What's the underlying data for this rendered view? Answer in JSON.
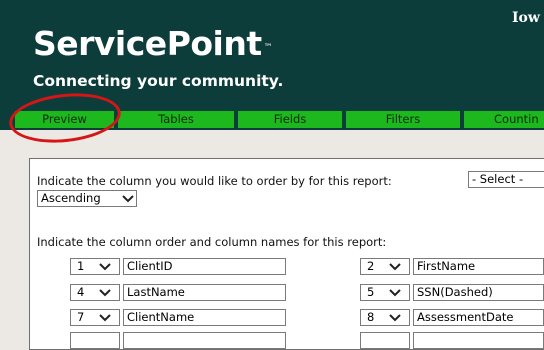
{
  "header": {
    "logo_text": "ServicePoint",
    "trademark": "™",
    "tagline": "Connecting your community.",
    "org_name": "Iow"
  },
  "tabs": [
    {
      "label": "Preview"
    },
    {
      "label": "Tables"
    },
    {
      "label": "Fields"
    },
    {
      "label": "Filters"
    },
    {
      "label": "Countin"
    }
  ],
  "order_section": {
    "prompt": "Indicate the column you would like to order by for this report:",
    "order_by_value": "- Select -",
    "direction_value": "Ascending"
  },
  "columns_section": {
    "prompt": "Indicate the column order and column names for this report:",
    "rows": [
      {
        "left_num": "1",
        "left_name": "ClientID",
        "right_num": "2",
        "right_name": "FirstName"
      },
      {
        "left_num": "4",
        "left_name": "LastName",
        "right_num": "5",
        "right_name": "SSN(Dashed)"
      },
      {
        "left_num": "7",
        "left_name": "ClientName",
        "right_num": "8",
        "right_name": "AssessmentDate"
      }
    ]
  },
  "colors": {
    "header_bg": "#0d3d3b",
    "tab_green": "#1db81d",
    "annotation_red": "#d61616"
  }
}
